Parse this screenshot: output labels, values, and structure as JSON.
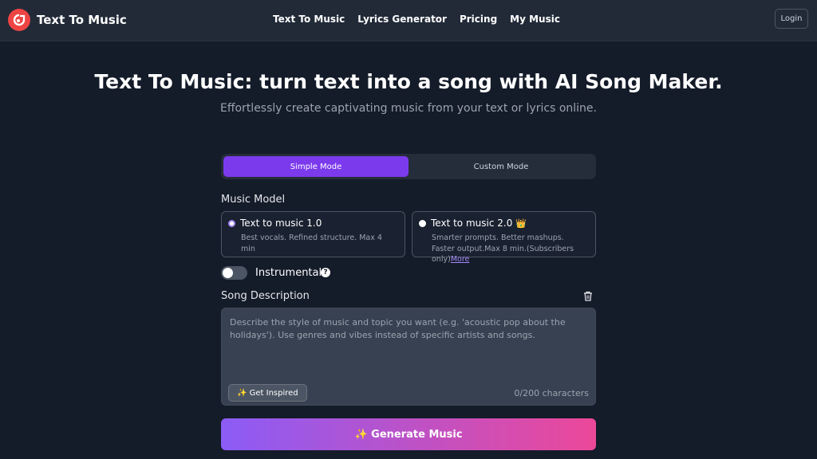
{
  "header": {
    "brand": "Text To Music",
    "nav": [
      "Text To Music",
      "Lyrics Generator",
      "Pricing",
      "My Music"
    ],
    "login": "Login"
  },
  "hero": {
    "title": "Text To Music: turn text into a song with AI Song Maker.",
    "subtitle": "Effortlessly create captivating music from your text or lyrics online."
  },
  "modes": {
    "tabs": [
      "Simple Mode",
      "Custom Mode"
    ],
    "active": "Simple Mode"
  },
  "music_model": {
    "label": "Music Model",
    "options": [
      {
        "title": "Text to music 1.0",
        "desc": "Best vocals. Refined structure. Max 4 min",
        "selected": true
      },
      {
        "title": "Text to music 2.0",
        "badge": "👑",
        "desc": "Smarter prompts. Better mashups. Faster output.Max 8 min.(Subscribers only)",
        "link": "More",
        "selected": false
      }
    ]
  },
  "instrumental": {
    "label": "Instrumental",
    "help": "?",
    "on": false
  },
  "song_description": {
    "label": "Song Description",
    "placeholder": "Describe the style of music and topic you want (e.g. 'acoustic pop about the holidays'). Use genres and vibes instead of specific artists and songs.",
    "value": "",
    "inspire": "✨ Get Inspired",
    "char_count": "0/200 characters"
  },
  "generate": {
    "label": "✨ Generate Music"
  },
  "colors": {
    "accent": "#7c3aed",
    "gradient_start": "#8b5cf6",
    "gradient_end": "#ec4899",
    "logo": "#ef4444"
  },
  "icons": [
    "logo-icon",
    "crown-icon",
    "help-icon",
    "trash-icon",
    "sparkles-icon"
  ]
}
